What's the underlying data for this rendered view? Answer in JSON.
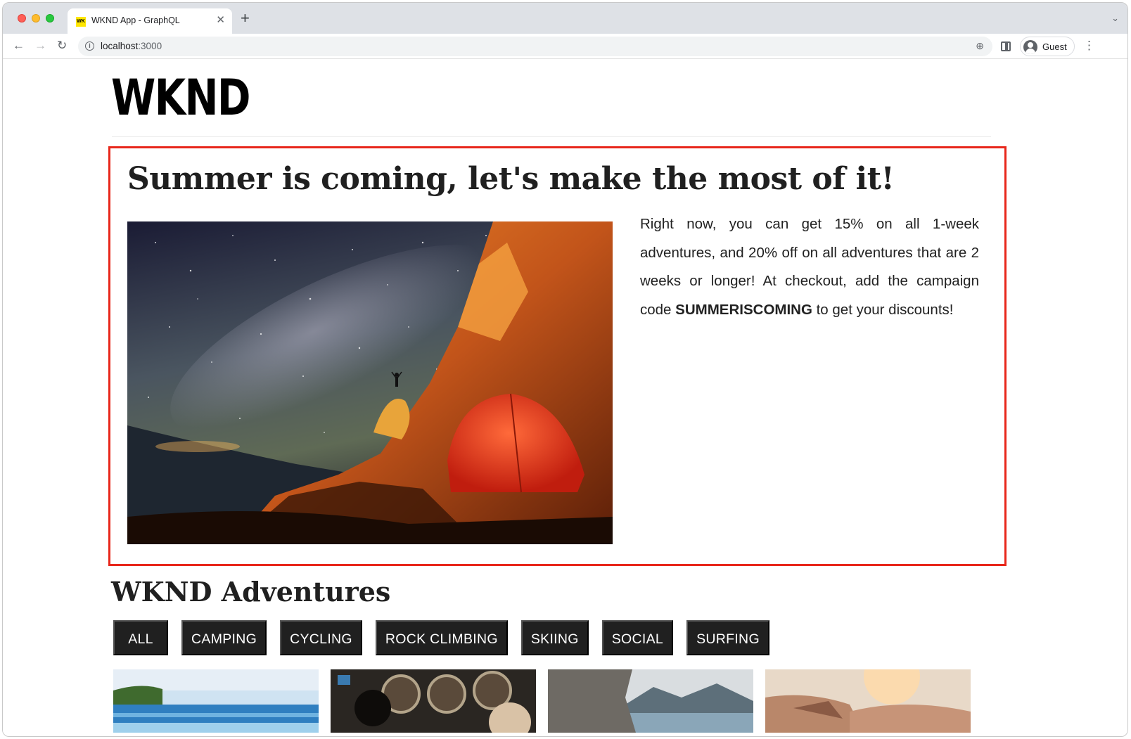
{
  "browser": {
    "tab_title": "WKND App - GraphQL",
    "favicon_text": "WK",
    "url_host": "localhost",
    "url_port": ":3000",
    "profile_label": "Guest"
  },
  "page": {
    "logo": "WKND",
    "promo": {
      "title": "Summer is coming, let's make the most of it!",
      "text_before": "Right now, you can get 15% on all 1-week adventures, and 20% off on all adventures that are 2 weeks or longer! At checkout, add the campaign code ",
      "code": "SUMMERISCOMING",
      "text_after": " to get your discounts!"
    },
    "adventures": {
      "title": "WKND Adventures",
      "filters": [
        {
          "label": "ALL"
        },
        {
          "label": "CAMPING"
        },
        {
          "label": "CYCLING"
        },
        {
          "label": "ROCK CLIMBING"
        },
        {
          "label": "SKIING"
        },
        {
          "label": "SOCIAL"
        },
        {
          "label": "SURFING"
        }
      ]
    }
  }
}
